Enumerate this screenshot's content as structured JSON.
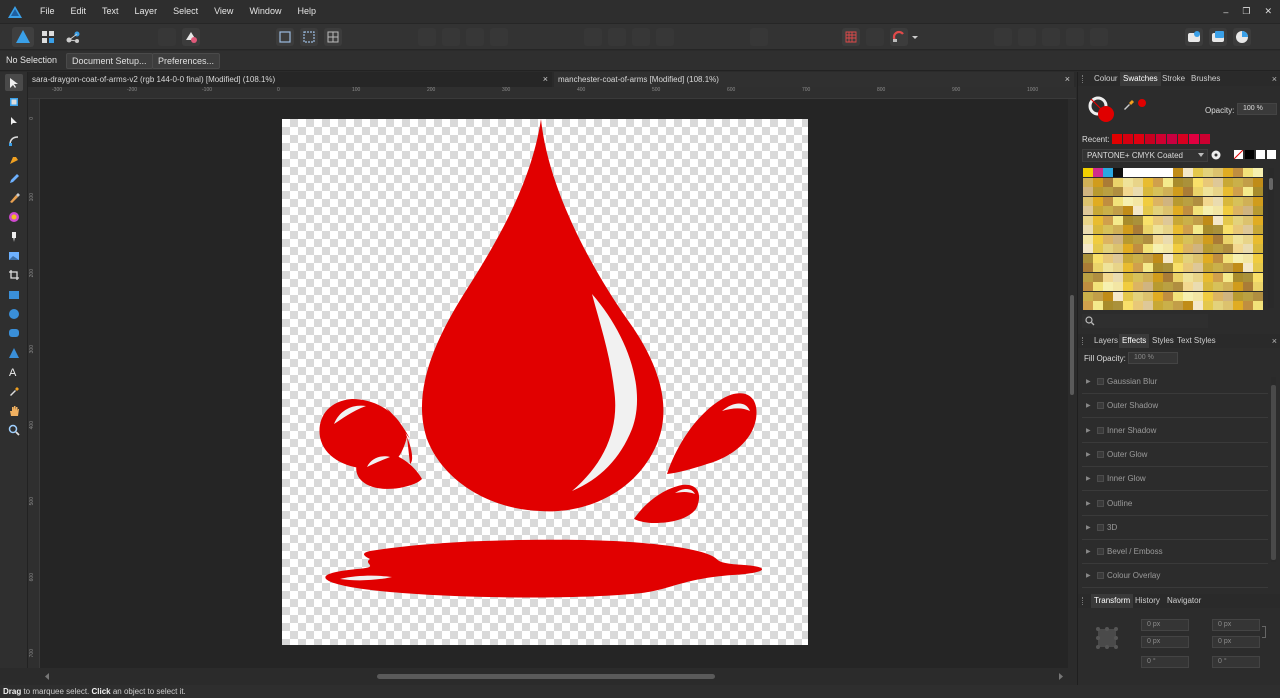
{
  "menu": {
    "items": [
      "File",
      "Edit",
      "Text",
      "Layer",
      "Select",
      "View",
      "Window",
      "Help"
    ]
  },
  "window_controls": {
    "minimize": "–",
    "restore": "❐",
    "close": "✕"
  },
  "context": {
    "selection": "No Selection",
    "document_setup": "Document Setup...",
    "preferences": "Preferences..."
  },
  "tabs": [
    {
      "label": "sara-draygon-coat-of-arms-v2 (rgb 144-0-0 final) [Modified] (108.1%)",
      "close": "×"
    },
    {
      "label": "manchester-coat-of-arms [Modified] (108.1%)",
      "close": "×"
    }
  ],
  "rulers": {
    "h": [
      "-300",
      "-200",
      "-100",
      "0",
      "100",
      "200",
      "300",
      "400",
      "500",
      "600",
      "700",
      "800",
      "900",
      "1000"
    ],
    "v": [
      "0",
      "100",
      "200",
      "300",
      "400",
      "500",
      "600",
      "700"
    ]
  },
  "colours": {
    "accent": "#e00000",
    "drop": "#e10000",
    "highlight": "#f1f1f1",
    "canvas_bg": "#252525"
  },
  "colour_panel": {
    "tabs": [
      "Colour",
      "Swatches",
      "Stroke",
      "Brushes"
    ],
    "active_tab": "Swatches",
    "opacity_label": "Opacity:",
    "opacity_value": "100 %",
    "recent_label": "Recent:",
    "palette_name": "PANTONE+ CMYK Coated",
    "close": "×"
  },
  "effects_panel": {
    "tabs": [
      "Layers",
      "Effects",
      "Styles",
      "Text Styles"
    ],
    "active_tab": "Effects",
    "fill_opacity_label": "Fill Opacity:",
    "fill_opacity_value": "100 %",
    "effects": [
      "Gaussian Blur",
      "Outer Shadow",
      "Inner Shadow",
      "Outer Glow",
      "Inner Glow",
      "Outline",
      "3D",
      "Bevel / Emboss",
      "Colour Overlay"
    ],
    "close": "×"
  },
  "transform_panel": {
    "tabs": [
      "Transform",
      "History",
      "Navigator"
    ],
    "active_tab": "Transform",
    "x": "0 px",
    "y": "0 px",
    "w": "0 px",
    "h": "0 px",
    "r": "0 °",
    "s": "0 °"
  },
  "status": {
    "drag": "Drag",
    "drag_text": " to marquee select. ",
    "click": "Click",
    "click_text": " an object to select it."
  }
}
